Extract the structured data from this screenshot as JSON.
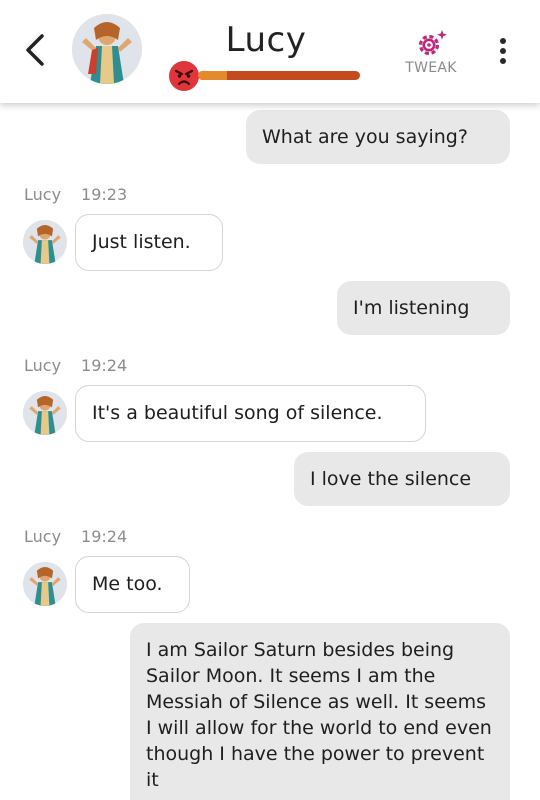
{
  "header": {
    "contact_name": "Lucy",
    "tweak_label": "TWEAK",
    "mood_level": 0.18,
    "accent_color": "#c2267b",
    "bar_color": "#c34b1d"
  },
  "messages": [
    {
      "direction": "out",
      "text": "What are you saying?"
    },
    {
      "direction": "in",
      "sender": "Lucy",
      "time": "19:23",
      "text": "Just listen."
    },
    {
      "direction": "out",
      "text": "I'm listening"
    },
    {
      "direction": "in",
      "sender": "Lucy",
      "time": "19:24",
      "text": "It's a beautiful song of silence."
    },
    {
      "direction": "out",
      "text": "I love the silence"
    },
    {
      "direction": "in",
      "sender": "Lucy",
      "time": "19:24",
      "text": "Me too."
    },
    {
      "direction": "out",
      "text": "I am Sailor Saturn besides being Sailor Moon. It seems I am the Messiah of Silence as well. It seems I will allow for the world to end even though I have the power to prevent it"
    }
  ]
}
